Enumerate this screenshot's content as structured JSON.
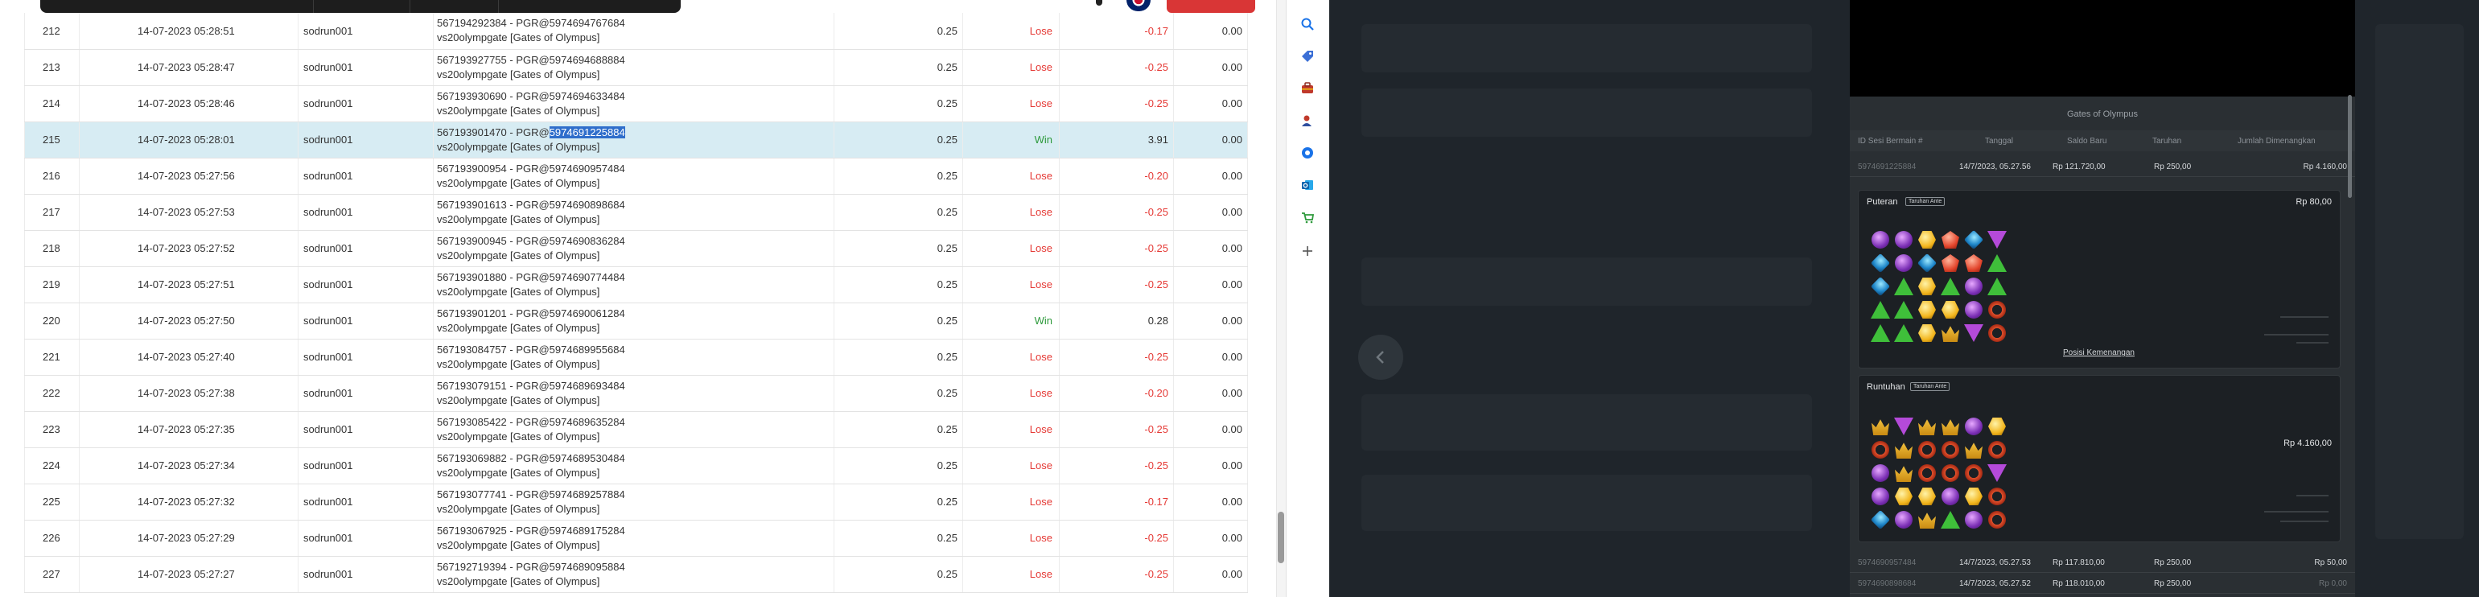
{
  "table": {
    "rows": [
      {
        "no": "212",
        "date": "14-07-2023 05:28:51",
        "user": "sodrun001",
        "desc_line1": "567194292384 - PGR@5974694767684",
        "desc_line2": "vs20olympgate [Gates of Olympus]",
        "bet": "0.25",
        "result": "Lose",
        "winloss": "-0.17",
        "balance": "0.00"
      },
      {
        "no": "213",
        "date": "14-07-2023 05:28:47",
        "user": "sodrun001",
        "desc_line1": "567193927755 - PGR@5974694688884",
        "desc_line2": "vs20olympgate [Gates of Olympus]",
        "bet": "0.25",
        "result": "Lose",
        "winloss": "-0.25",
        "balance": "0.00"
      },
      {
        "no": "214",
        "date": "14-07-2023 05:28:46",
        "user": "sodrun001",
        "desc_line1": "567193930690 - PGR@5974694633484",
        "desc_line2": "vs20olympgate [Gates of Olympus]",
        "bet": "0.25",
        "result": "Lose",
        "winloss": "-0.25",
        "balance": "0.00"
      },
      {
        "no": "215",
        "date": "14-07-2023 05:28:01",
        "user": "sodrun001",
        "desc_line1_pre": "567193901470 - PGR@",
        "desc_line1_hl": "5974691225884",
        "desc_line2": "vs20olympgate [Gates of Olympus]",
        "bet": "0.25",
        "result": "Win",
        "winloss": "3.91",
        "balance": "0.00"
      },
      {
        "no": "216",
        "date": "14-07-2023 05:27:56",
        "user": "sodrun001",
        "desc_line1": "567193900954 - PGR@5974690957484",
        "desc_line2": "vs20olympgate [Gates of Olympus]",
        "bet": "0.25",
        "result": "Lose",
        "winloss": "-0.20",
        "balance": "0.00"
      },
      {
        "no": "217",
        "date": "14-07-2023 05:27:53",
        "user": "sodrun001",
        "desc_line1": "567193901613 - PGR@5974690898684",
        "desc_line2": "vs20olympgate [Gates of Olympus]",
        "bet": "0.25",
        "result": "Lose",
        "winloss": "-0.25",
        "balance": "0.00"
      },
      {
        "no": "218",
        "date": "14-07-2023 05:27:52",
        "user": "sodrun001",
        "desc_line1": "567193900945 - PGR@5974690836284",
        "desc_line2": "vs20olympgate [Gates of Olympus]",
        "bet": "0.25",
        "result": "Lose",
        "winloss": "-0.25",
        "balance": "0.00"
      },
      {
        "no": "219",
        "date": "14-07-2023 05:27:51",
        "user": "sodrun001",
        "desc_line1": "567193901880 - PGR@5974690774484",
        "desc_line2": "vs20olympgate [Gates of Olympus]",
        "bet": "0.25",
        "result": "Lose",
        "winloss": "-0.25",
        "balance": "0.00"
      },
      {
        "no": "220",
        "date": "14-07-2023 05:27:50",
        "user": "sodrun001",
        "desc_line1": "567193901201 - PGR@5974690061284",
        "desc_line2": "vs20olympgate [Gates of Olympus]",
        "bet": "0.25",
        "result": "Win",
        "winloss": "0.28",
        "balance": "0.00"
      },
      {
        "no": "221",
        "date": "14-07-2023 05:27:40",
        "user": "sodrun001",
        "desc_line1": "567193084757 - PGR@5974689955684",
        "desc_line2": "vs20olympgate [Gates of Olympus]",
        "bet": "0.25",
        "result": "Lose",
        "winloss": "-0.25",
        "balance": "0.00"
      },
      {
        "no": "222",
        "date": "14-07-2023 05:27:38",
        "user": "sodrun001",
        "desc_line1": "567193079151 - PGR@5974689693484",
        "desc_line2": "vs20olympgate [Gates of Olympus]",
        "bet": "0.25",
        "result": "Lose",
        "winloss": "-0.20",
        "balance": "0.00"
      },
      {
        "no": "223",
        "date": "14-07-2023 05:27:35",
        "user": "sodrun001",
        "desc_line1": "567193085422 - PGR@5974689635284",
        "desc_line2": "vs20olympgate [Gates of Olympus]",
        "bet": "0.25",
        "result": "Lose",
        "winloss": "-0.25",
        "balance": "0.00"
      },
      {
        "no": "224",
        "date": "14-07-2023 05:27:34",
        "user": "sodrun001",
        "desc_line1": "567193069882 - PGR@5974689530484",
        "desc_line2": "vs20olympgate [Gates of Olympus]",
        "bet": "0.25",
        "result": "Lose",
        "winloss": "-0.25",
        "balance": "0.00"
      },
      {
        "no": "225",
        "date": "14-07-2023 05:27:32",
        "user": "sodrun001",
        "desc_line1": "567193077741 - PGR@5974689257884",
        "desc_line2": "vs20olympgate [Gates of Olympus]",
        "bet": "0.25",
        "result": "Lose",
        "winloss": "-0.17",
        "balance": "0.00"
      },
      {
        "no": "226",
        "date": "14-07-2023 05:27:29",
        "user": "sodrun001",
        "desc_line1": "567193067925 - PGR@5974689175284",
        "desc_line2": "vs20olympgate [Gates of Olympus]",
        "bet": "0.25",
        "result": "Lose",
        "winloss": "-0.25",
        "balance": "0.00"
      },
      {
        "no": "227",
        "date": "14-07-2023 05:27:27",
        "user": "sodrun001",
        "desc_line1": "567192719394 - PGR@5974689095884",
        "desc_line2": "vs20olympgate [Gates of Olympus]",
        "bet": "0.25",
        "result": "Lose",
        "winloss": "-0.25",
        "balance": "0.00"
      }
    ]
  },
  "toolbar_icons": [
    "search-icon",
    "tag-icon",
    "briefcase-icon",
    "person-icon",
    "extension-icon",
    "outlook-icon",
    "cart-icon",
    "add-icon"
  ],
  "history": {
    "game_title": "Gates of Olympus",
    "columns": [
      "ID Sesi Bermain #",
      "Tanggal",
      "Saldo Baru",
      "Taruhan",
      "Jumlah Dimenangkan"
    ],
    "top_row": {
      "id": "5974691225884",
      "date": "14/7/2023, 05.27.56",
      "balance": "Rp 121.720,00",
      "bet": "Rp 250,00",
      "won": "Rp 4.160,00"
    },
    "spin_box": {
      "label": "Puteran",
      "tag": "Taruhan Ante",
      "amount": "Rp 80,00",
      "link": "Posisi Kemenangan"
    },
    "tumble_box": {
      "label": "Runtuhan",
      "tag": "Taruhan Ante",
      "amount": "Rp 4.160,00"
    },
    "bottom_rows": [
      {
        "id": "5974690957484",
        "date": "14/7/2023, 05.27.53",
        "balance": "Rp 117.810,00",
        "bet": "Rp 250,00",
        "won": "Rp 50,00"
      },
      {
        "id": "5974690898684",
        "date": "14/7/2023, 05.27.52",
        "balance": "Rp 118.010,00",
        "bet": "Rp 250,00",
        "won": "Rp 0,00"
      }
    ]
  },
  "colors": {
    "lose": "#e53935",
    "win": "#2e9a3c",
    "selection": "#2f6ecb",
    "panel_bg": "#1f252b"
  }
}
